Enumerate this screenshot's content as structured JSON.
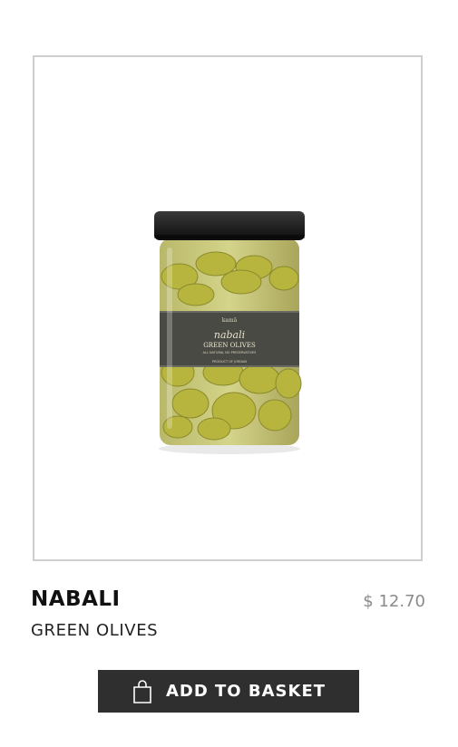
{
  "product": {
    "name": "NABALI",
    "subtitle": "GREEN OLIVES",
    "price": "$ 12.70",
    "image": {
      "icon": "olive-jar-image",
      "label_brand": "kamā",
      "label_script": "nabali",
      "label_title": "GREEN OLIVES",
      "label_line": "ALL NATURAL NO PRESERVATIVES",
      "label_origin": "PRODUCT OF JORDAN"
    }
  },
  "actions": {
    "add_to_basket_label": "ADD TO BASKET",
    "add_to_basket_icon": "shopping-bag-icon"
  },
  "colors": {
    "button_bg": "#2f2f2f",
    "price_text": "#8a8a8a",
    "frame_border": "#cfcfcf"
  }
}
